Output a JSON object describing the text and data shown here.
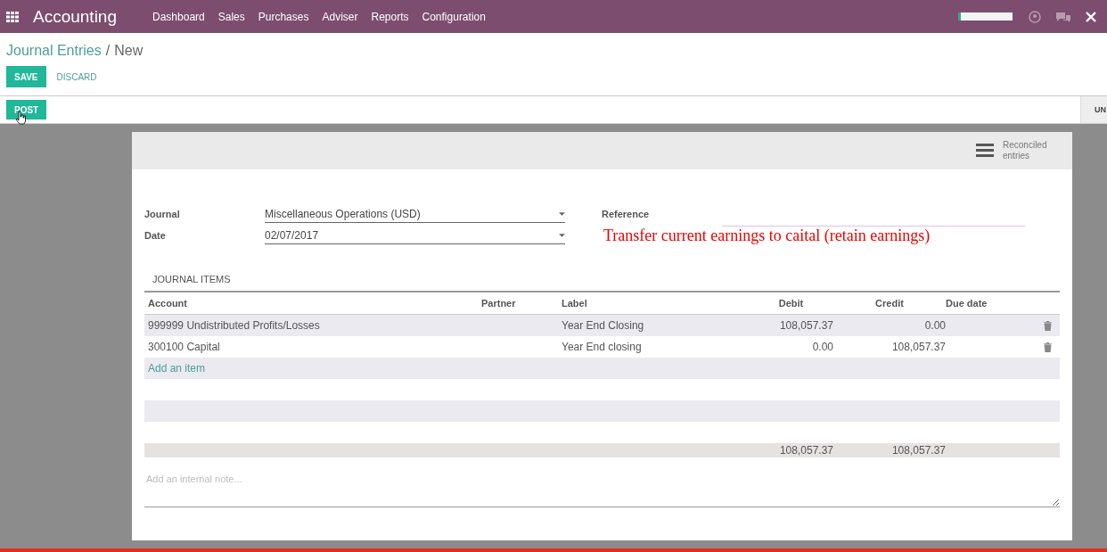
{
  "app": {
    "title": "Accounting",
    "menu": [
      "Dashboard",
      "Sales",
      "Purchases",
      "Adviser",
      "Reports",
      "Configuration"
    ]
  },
  "breadcrumb": {
    "parent": "Journal Entries",
    "separator": "/",
    "current": "New"
  },
  "actions": {
    "save": "SAVE",
    "discard": "DISCARD"
  },
  "status_bar": {
    "post": "POST",
    "right_button": "UN"
  },
  "sheet": {
    "smart_button": "Reconciled entries",
    "fields": [
      {
        "label": "Journal",
        "value": "Miscellaneous Operations (USD)"
      },
      {
        "label": "Date",
        "value": "02/07/2017"
      }
    ],
    "reference": {
      "label": "Reference"
    },
    "annotation": "Transfer current earnings to caital (retain earnings)",
    "tab": "JOURNAL ITEMS",
    "columns": [
      "Account",
      "Partner",
      "Label",
      "Debit",
      "Credit",
      "Due date"
    ],
    "rows": [
      {
        "account": "999999 Undistributed Profits/Losses",
        "label": "Year End Closing",
        "debit": "108,057.37",
        "credit": "0.00"
      },
      {
        "account": "300100 Capital",
        "label": "Year End closing",
        "debit": "0.00",
        "credit": "108,057.37"
      }
    ],
    "add_item": "Add an item",
    "totals": {
      "debit": "108,057.37",
      "credit": "108,057.37"
    },
    "note": {
      "placeholder": "Add an internal note..."
    }
  }
}
